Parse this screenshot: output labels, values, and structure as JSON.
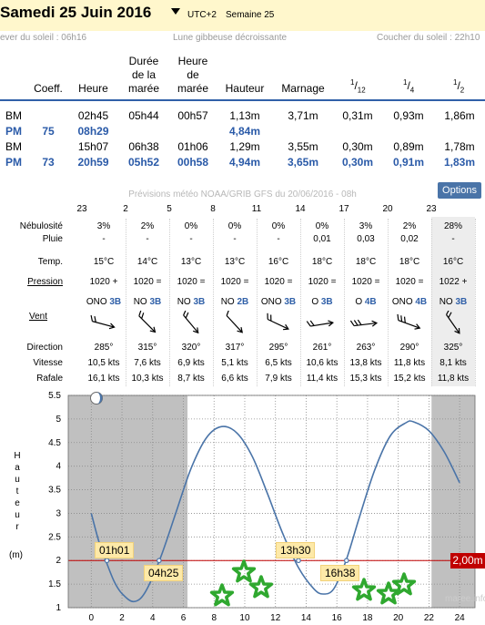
{
  "header": {
    "title": "Samedi 25 Juin 2016",
    "utc": "UTC+2",
    "week": "Semaine 25"
  },
  "sun": {
    "sunrise": "ever du soleil : 06h16",
    "moon": "Lune gibbeuse décroissante",
    "sunset": "Coucher du soleil : 22h10"
  },
  "tides": {
    "headers": {
      "coeff": "Coeff.",
      "heure": "Heure",
      "duree": [
        "Durée",
        "de la",
        "marée"
      ],
      "heure_maree": [
        "Heure",
        "de",
        "marée"
      ],
      "hauteur": "Hauteur",
      "marnage": "Marnage",
      "f12": [
        "1",
        "12"
      ],
      "f4": [
        "1",
        "4"
      ],
      "f2": [
        "1",
        "2"
      ]
    },
    "rows": [
      {
        "type": "BM",
        "coeff": "",
        "heure": "02h45",
        "duree": "05h44",
        "heure_maree": "00h57",
        "hauteur": "1,13m",
        "marnage": "3,71m",
        "f12": "0,31m",
        "f4": "0,93m",
        "f2": "1,86m"
      },
      {
        "type": "PM",
        "coeff": "75",
        "heure": "08h29",
        "duree": "",
        "heure_maree": "",
        "hauteur": "4,84m",
        "marnage": "",
        "f12": "",
        "f4": "",
        "f2": ""
      },
      {
        "type": "BM",
        "coeff": "",
        "heure": "15h07",
        "duree": "06h38",
        "heure_maree": "01h06",
        "hauteur": "1,29m",
        "marnage": "3,55m",
        "f12": "0,30m",
        "f4": "0,89m",
        "f2": "1,78m"
      },
      {
        "type": "PM",
        "coeff": "73",
        "heure": "20h59",
        "duree": "05h52",
        "heure_maree": "00h58",
        "hauteur": "4,94m",
        "marnage": "3,65m",
        "f12": "0,30m",
        "f4": "0,91m",
        "f2": "1,83m"
      }
    ]
  },
  "forecast": {
    "title": "Prévisions météo NOAA/GRIB GFS du 20/06/2016 - 08h",
    "options_label": "Options",
    "hours": [
      "23",
      "2",
      "5",
      "8",
      "11",
      "14",
      "17",
      "20",
      "23"
    ],
    "row_labels": {
      "nebulosite": "Nébulosité",
      "pluie": "Pluie",
      "temp": "Temp.",
      "pression": "Pression",
      "vent": "Vent",
      "direction": "Direction",
      "vitesse": "Vitesse",
      "rafale": "Rafale"
    },
    "columns": [
      {
        "neb": "3%",
        "pluie": "-",
        "temp": "15°C",
        "pression": "1020 +",
        "vent_dir": "ONO",
        "vent_force": "3B",
        "dir_deg": "285°",
        "vitesse": "10,5 kts",
        "rafale": "16,1 kts"
      },
      {
        "neb": "2%",
        "pluie": "-",
        "temp": "14°C",
        "pression": "1020 =",
        "vent_dir": "NO",
        "vent_force": "3B",
        "dir_deg": "315°",
        "vitesse": "7,6 kts",
        "rafale": "10,3 kts"
      },
      {
        "neb": "0%",
        "pluie": "-",
        "temp": "13°C",
        "pression": "1020 =",
        "vent_dir": "NO",
        "vent_force": "3B",
        "dir_deg": "320°",
        "vitesse": "6,9 kts",
        "rafale": "8,7 kts"
      },
      {
        "neb": "0%",
        "pluie": "-",
        "temp": "13°C",
        "pression": "1020 =",
        "vent_dir": "NO",
        "vent_force": "2B",
        "dir_deg": "317°",
        "vitesse": "5,1 kts",
        "rafale": "6,6 kts"
      },
      {
        "neb": "0%",
        "pluie": "-",
        "temp": "16°C",
        "pression": "1020 =",
        "vent_dir": "ONO",
        "vent_force": "3B",
        "dir_deg": "295°",
        "vitesse": "6,5 kts",
        "rafale": "7,9 kts"
      },
      {
        "neb": "0%",
        "pluie": "0,01",
        "temp": "18°C",
        "pression": "1020 =",
        "vent_dir": "O",
        "vent_force": "3B",
        "dir_deg": "261°",
        "vitesse": "10,6 kts",
        "rafale": "11,4 kts"
      },
      {
        "neb": "3%",
        "pluie": "0,03",
        "temp": "18°C",
        "pression": "1020 =",
        "vent_dir": "O",
        "vent_force": "4B",
        "dir_deg": "263°",
        "vitesse": "13,8 kts",
        "rafale": "15,3 kts"
      },
      {
        "neb": "2%",
        "pluie": "0,02",
        "temp": "18°C",
        "pression": "1020 =",
        "vent_dir": "ONO",
        "vent_force": "4B",
        "dir_deg": "290°",
        "vitesse": "11,8 kts",
        "rafale": "15,2 kts"
      },
      {
        "neb": "28%",
        "pluie": "-",
        "temp": "16°C",
        "pression": "1022 +",
        "vent_dir": "NO",
        "vent_force": "3B",
        "dir_deg": "325°",
        "vitesse": "8,1 kts",
        "rafale": "11,8 kts"
      }
    ]
  },
  "chart": {
    "yaxis_title": "Hauteur",
    "yaxis_unit": "(m)",
    "reference_label": "2,00m",
    "crossings": [
      "01h01",
      "04h25",
      "13h30",
      "16h38"
    ],
    "watermark": "maree.info",
    "night_color": "#c0c0c0",
    "curve_color": "#4a74a8",
    "reference_color": "#c00000"
  },
  "chart_data": {
    "type": "line",
    "x": [
      0,
      0.5,
      1,
      1.5,
      2,
      2.75,
      3.5,
      4.5,
      5.5,
      6.5,
      7.5,
      8.5,
      9.5,
      10.5,
      11.5,
      12.5,
      13.5,
      14.5,
      15.1,
      15.8,
      16.6,
      17.5,
      18.5,
      19.5,
      20.5,
      21,
      22,
      23,
      24
    ],
    "y": [
      3.0,
      2.4,
      1.95,
      1.55,
      1.3,
      1.13,
      1.32,
      2.05,
      3.0,
      3.95,
      4.6,
      4.84,
      4.7,
      4.2,
      3.4,
      2.55,
      1.85,
      1.4,
      1.29,
      1.4,
      2.0,
      2.95,
      3.95,
      4.65,
      4.92,
      4.94,
      4.75,
      4.3,
      3.65
    ],
    "xlim": [
      -1.5,
      25
    ],
    "ylim": [
      1,
      5.5
    ],
    "xticks": [
      0,
      2,
      4,
      6,
      8,
      10,
      12,
      14,
      16,
      18,
      20,
      22,
      24
    ],
    "yticks": [
      1,
      1.5,
      2,
      2.5,
      3,
      3.5,
      4,
      4.5,
      5,
      5.5
    ],
    "reference_line": 2.0,
    "night_ranges": [
      [
        -1.5,
        6.27
      ],
      [
        22.17,
        25
      ]
    ],
    "xlabel": "",
    "ylabel": "Hauteur (m)"
  }
}
